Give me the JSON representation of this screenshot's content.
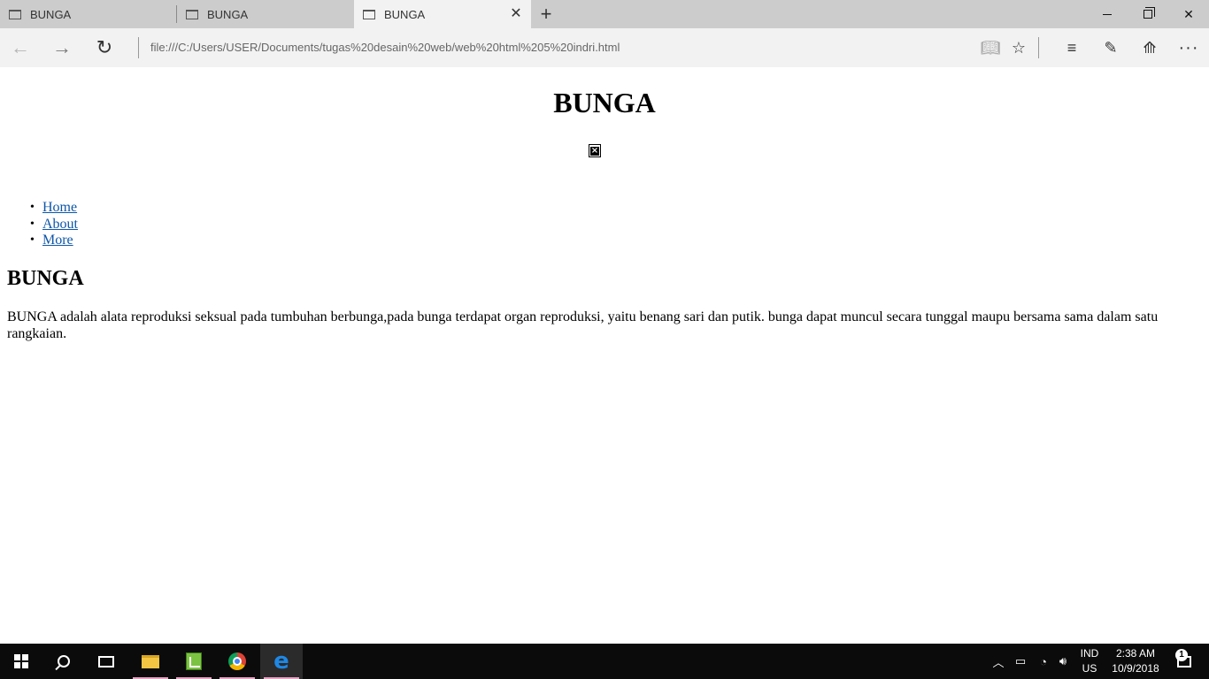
{
  "browser": {
    "tabs": [
      {
        "label": "BUNGA",
        "active": false
      },
      {
        "label": "BUNGA",
        "active": false
      },
      {
        "label": "BUNGA",
        "active": true
      }
    ],
    "address": "file:///C:/Users/USER/Documents/tugas%20desain%20web/web%20html%205%20indri.html",
    "icons": {
      "back": "arrow-left-icon",
      "forward": "arrow-right-icon",
      "refresh": "refresh-icon",
      "reading_view": "book-icon",
      "favorite": "star-icon",
      "hub": "hub-icon",
      "web_note": "pen-icon",
      "share": "share-icon",
      "more": "more-icon"
    }
  },
  "page": {
    "heading": "BUNGA",
    "image": "broken-image-icon",
    "menu": [
      "Home",
      "About",
      "More"
    ],
    "section_title": "BUNGA",
    "paragraph": "BUNGA adalah alata reproduksi seksual pada tumbuhan berbunga,pada bunga terdapat organ reproduksi, yaitu benang sari dan putik. bunga dapat muncul secara tunggal maupu bersama sama dalam satu rangkaian."
  },
  "taskbar": {
    "language_top": "IND",
    "language_bottom": "US",
    "time": "2:38 AM",
    "date": "10/9/2018",
    "notification_count": "1",
    "colors": {
      "background": "#0b0b0b",
      "app_underline": "#e8a3c4"
    }
  }
}
